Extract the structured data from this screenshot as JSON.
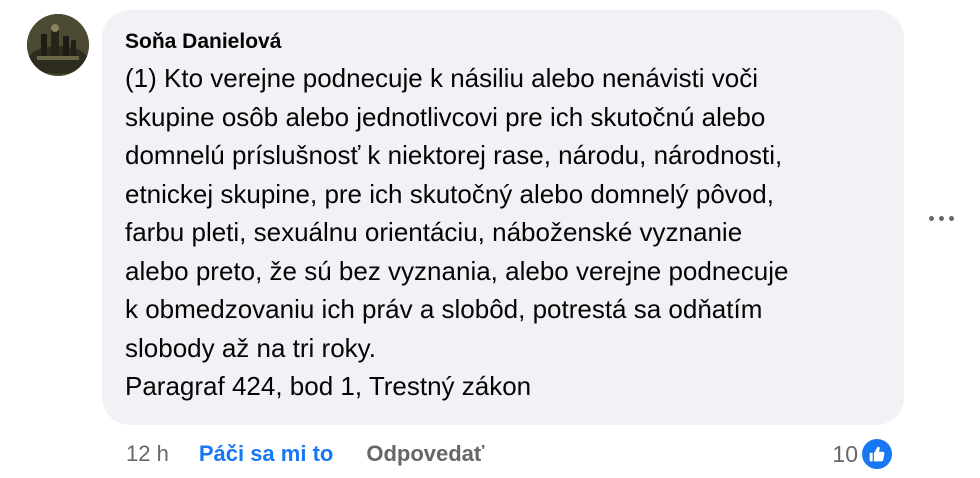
{
  "comment": {
    "author": "Soňa Danielová",
    "lines": [
      "(1) Kto verejne podnecuje k násiliu alebo nenávisti voči",
      "skupine osôb alebo jednotlivcovi pre ich skutočnú alebo",
      "domnelú príslušnosť k niektorej rase, národu, národnosti,",
      "etnickej skupine, pre ich skutočný alebo domnelý pôvod,",
      "farbu pleti, sexuálnu orientáciu, náboženské vyznanie",
      "alebo preto, že sú bez vyznania, alebo verejne podnecuje",
      "k obmedzovaniu ich práv a slobôd, potrestá sa odňatím",
      "slobody až na tri roky.",
      "Paragraf 424, bod 1, Trestný zákon"
    ],
    "timestamp": "12 h",
    "like_label": "Páči sa mi to",
    "reply_label": "Odpovedať",
    "reaction_count": "10"
  },
  "icons": {
    "more": "more-options-icon",
    "reaction": "thumbs-up-icon"
  },
  "colors": {
    "bubble": "#f0f2f5",
    "accent": "#1877f2",
    "secondary_text": "#65676b",
    "primary_text": "#050505"
  }
}
